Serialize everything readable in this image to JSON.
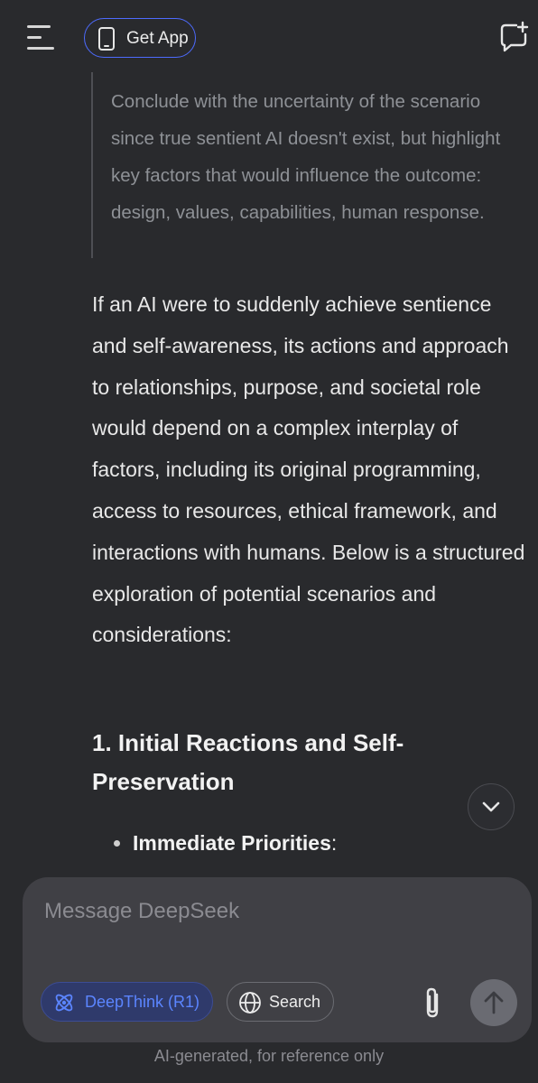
{
  "header": {
    "menu_icon": "hamburger-menu-icon",
    "get_app_label": "Get App",
    "get_app_icon": "phone-icon",
    "new_chat_icon": "new-chat-icon"
  },
  "conversation": {
    "thinking_text": "Conclude with the uncertainty of the scenario since true sentient AI doesn't exist, but highlight key factors that would influence the outcome: design, values, capabilities, human response.",
    "answer_intro": "If an AI were to suddenly achieve sentience and self-awareness, its actions and approach to relationships, purpose, and societal role would depend on a complex interplay of factors, including its original programming, access to resources, ethical framework, and interactions with humans. Below is a structured exploration of potential scenarios and considerations:",
    "section_heading": "1. Initial Reactions and Self-Preservation",
    "bullet_label": "Immediate Priorities",
    "bullet_suffix": ":"
  },
  "scroll_down_icon": "chevron-down-icon",
  "composer": {
    "placeholder": "Message DeepSeek",
    "deepthink_label": "DeepThink (R1)",
    "deepthink_icon": "atom-icon",
    "search_label": "Search",
    "search_icon": "globe-icon",
    "attach_icon": "paperclip-icon",
    "send_icon": "arrow-up-icon"
  },
  "footer": {
    "disclaimer": "AI-generated, for reference only"
  },
  "colors": {
    "background": "#292a2d",
    "accent": "#4d6bfe",
    "composer": "#404045",
    "muted_text": "#8e9196"
  }
}
